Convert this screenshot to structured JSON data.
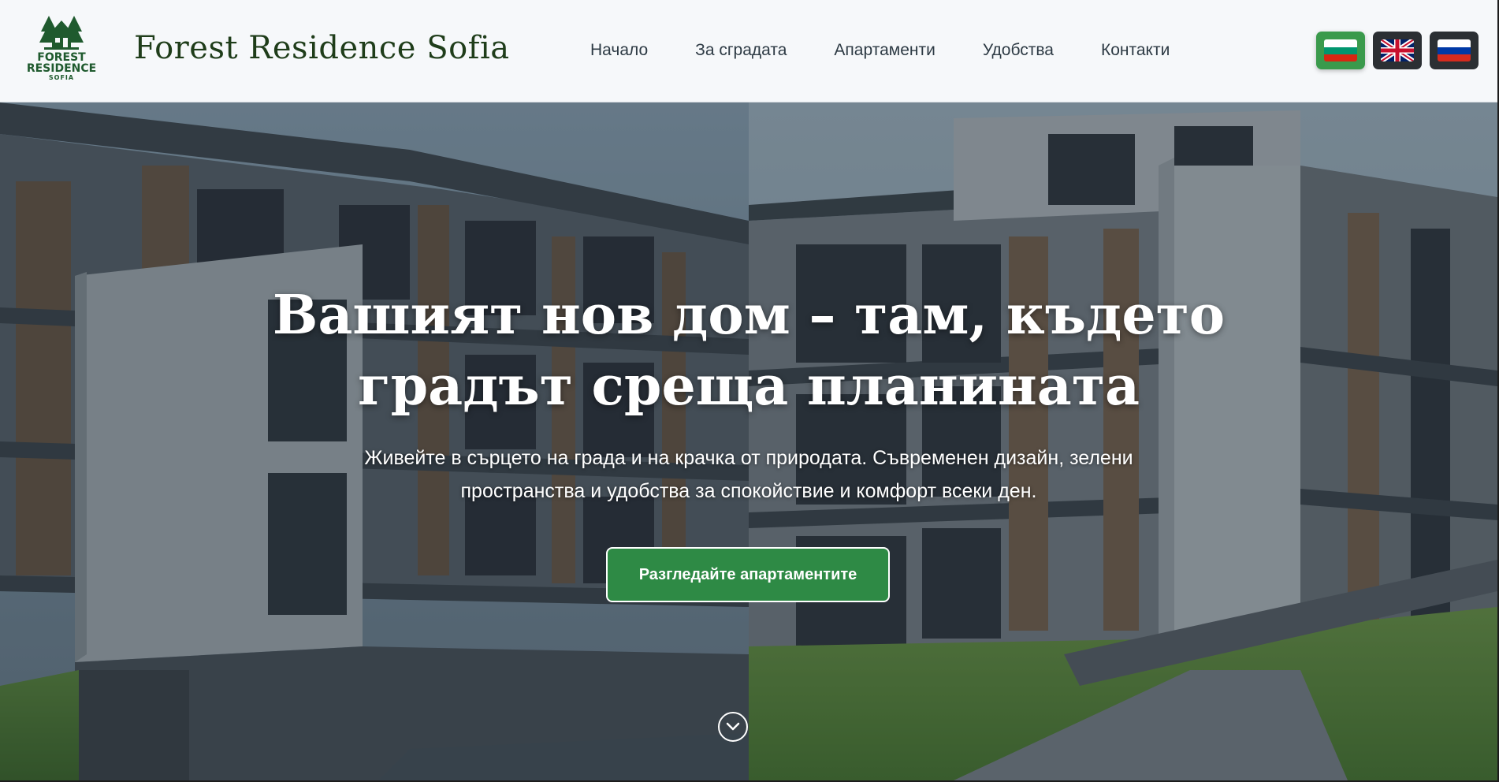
{
  "header": {
    "logo": {
      "line1": "FOREST",
      "line2": "RESIDENCE",
      "line3": "SOFIA",
      "icon": "forest-house-icon",
      "color": "#1f5a2e"
    },
    "brand": "Forest Residence Sofia",
    "nav": [
      {
        "label": "Начало"
      },
      {
        "label": "За сградата"
      },
      {
        "label": "Апартаменти"
      },
      {
        "label": "Удобства"
      },
      {
        "label": "Контакти"
      }
    ],
    "languages": [
      {
        "code": "bg",
        "icon": "bulgaria-flag-icon",
        "active": true
      },
      {
        "code": "en",
        "icon": "uk-flag-icon",
        "active": false
      },
      {
        "code": "ru",
        "icon": "russia-flag-icon",
        "active": false
      }
    ]
  },
  "hero": {
    "title_line1": "Вашият нов дом – там, където",
    "title_line2": "градът среща планината",
    "subtitle_line1": "Живейте в сърцето на града и на крачка от природата. Съвременен дизайн, зелени",
    "subtitle_line2": "пространства и удобства за спокойствие и комфорт всеки ден.",
    "cta": "Разгледайте апартаментите",
    "scroll_icon": "chevron-down-circle-icon"
  },
  "colors": {
    "accent_green": "#2e8a45",
    "active_lang": "#3a9a4c",
    "header_bg": "#f6f8fa"
  }
}
